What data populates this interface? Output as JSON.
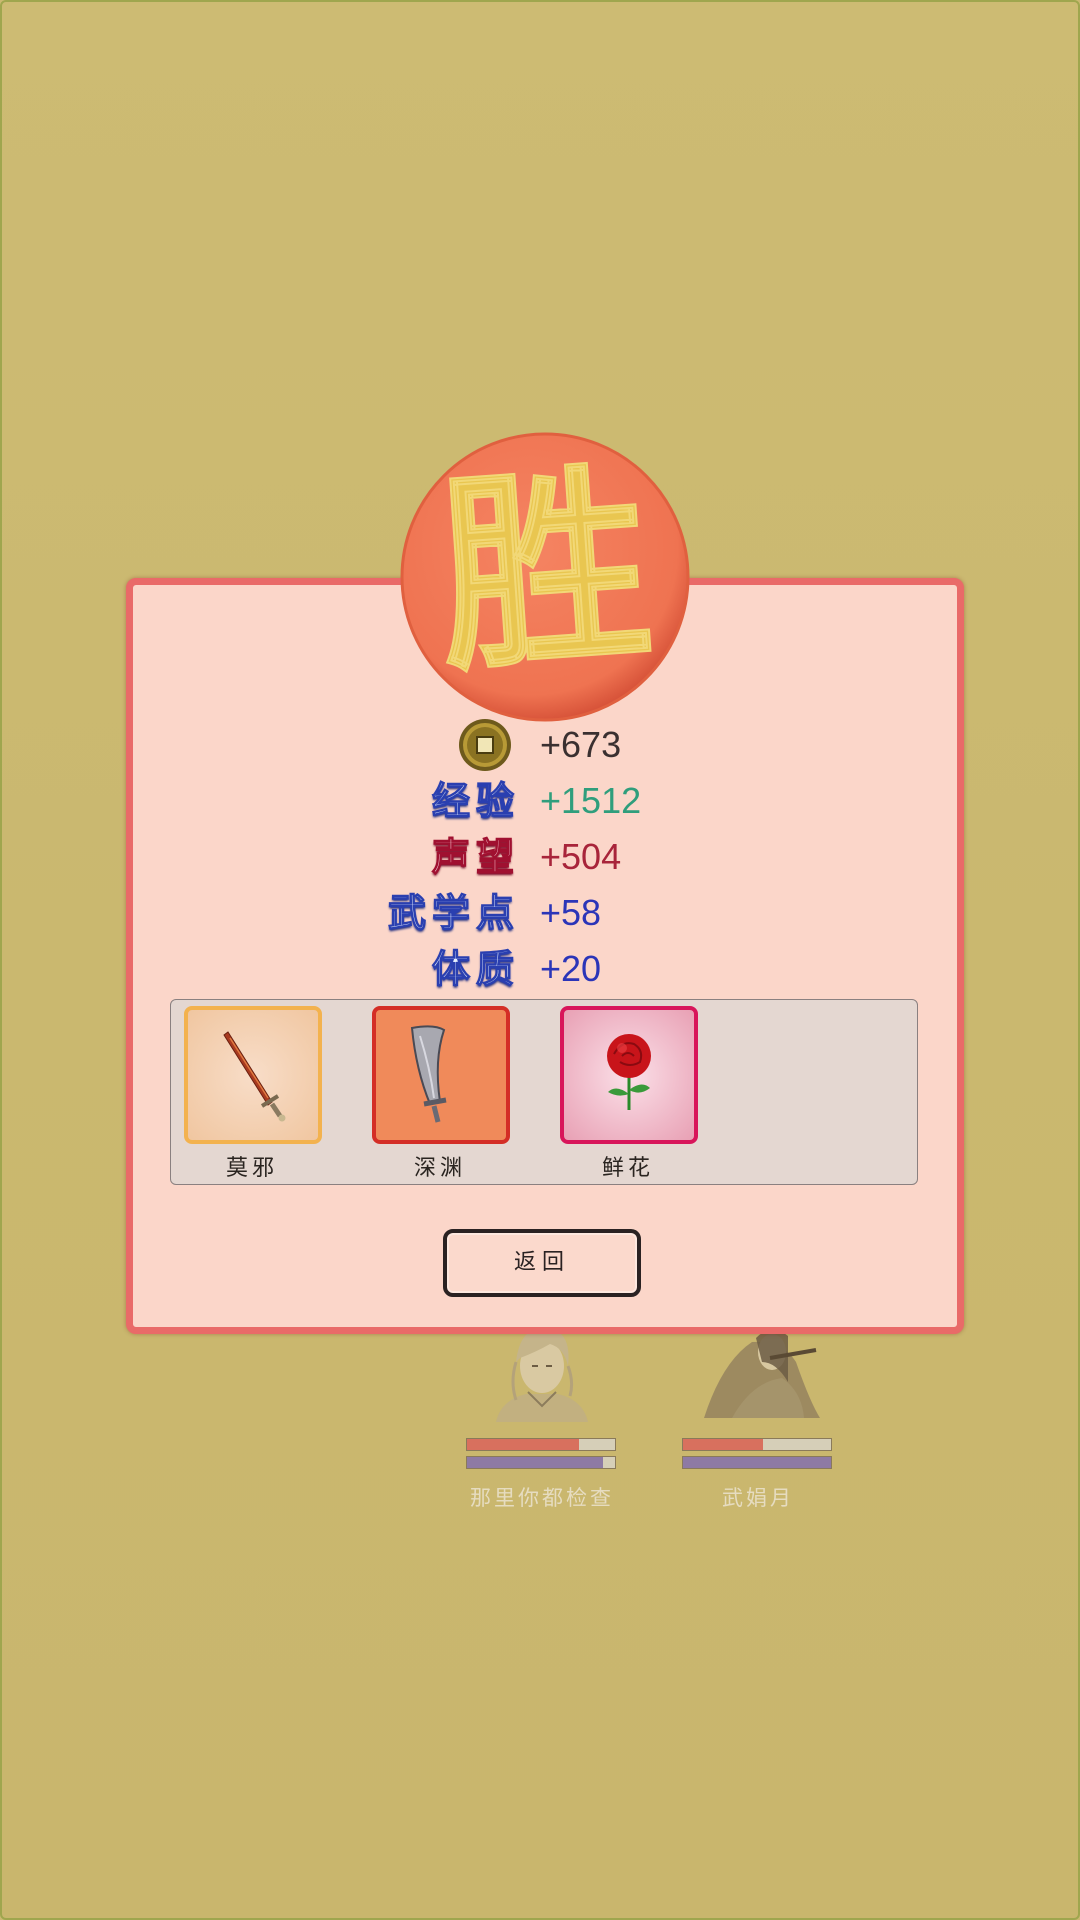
{
  "result": {
    "badge_text": "胜",
    "back_label": "返回"
  },
  "rewards": [
    {
      "label": "",
      "value": "+673",
      "icon": "copper-coin-icon",
      "color": "#3a3030"
    },
    {
      "label": "经验",
      "value": "+1512",
      "color": "#2f9e7c"
    },
    {
      "label": "声望",
      "value": "+504",
      "color": "#a8243a"
    },
    {
      "label": "武学点",
      "value": "+58",
      "color": "#2b35b8"
    },
    {
      "label": "体质",
      "value": "+20",
      "color": "#2b35b8"
    }
  ],
  "items": [
    {
      "name": "莫邪",
      "icon": "sword-icon",
      "rarity_color": "#f3b24e"
    },
    {
      "name": "深渊",
      "icon": "broadsword-icon",
      "rarity_color": "#d42e26"
    },
    {
      "name": "鲜花",
      "icon": "rose-icon",
      "rarity_color": "#d8155a"
    }
  ],
  "party": [
    {
      "name": "那里你都检查",
      "hp": 0.76,
      "mp": 0.92
    },
    {
      "name": "武娟月",
      "hp": 0.54,
      "mp": 1.0
    }
  ],
  "colors": {
    "background": "#cbb972",
    "panel": "#fbd6c9",
    "panel_border": "#e96a68",
    "badge": "#f07656",
    "badge_text": "#e9c650",
    "hp_bar": "#d8705e",
    "mp_bar": "#8e7aa4"
  }
}
